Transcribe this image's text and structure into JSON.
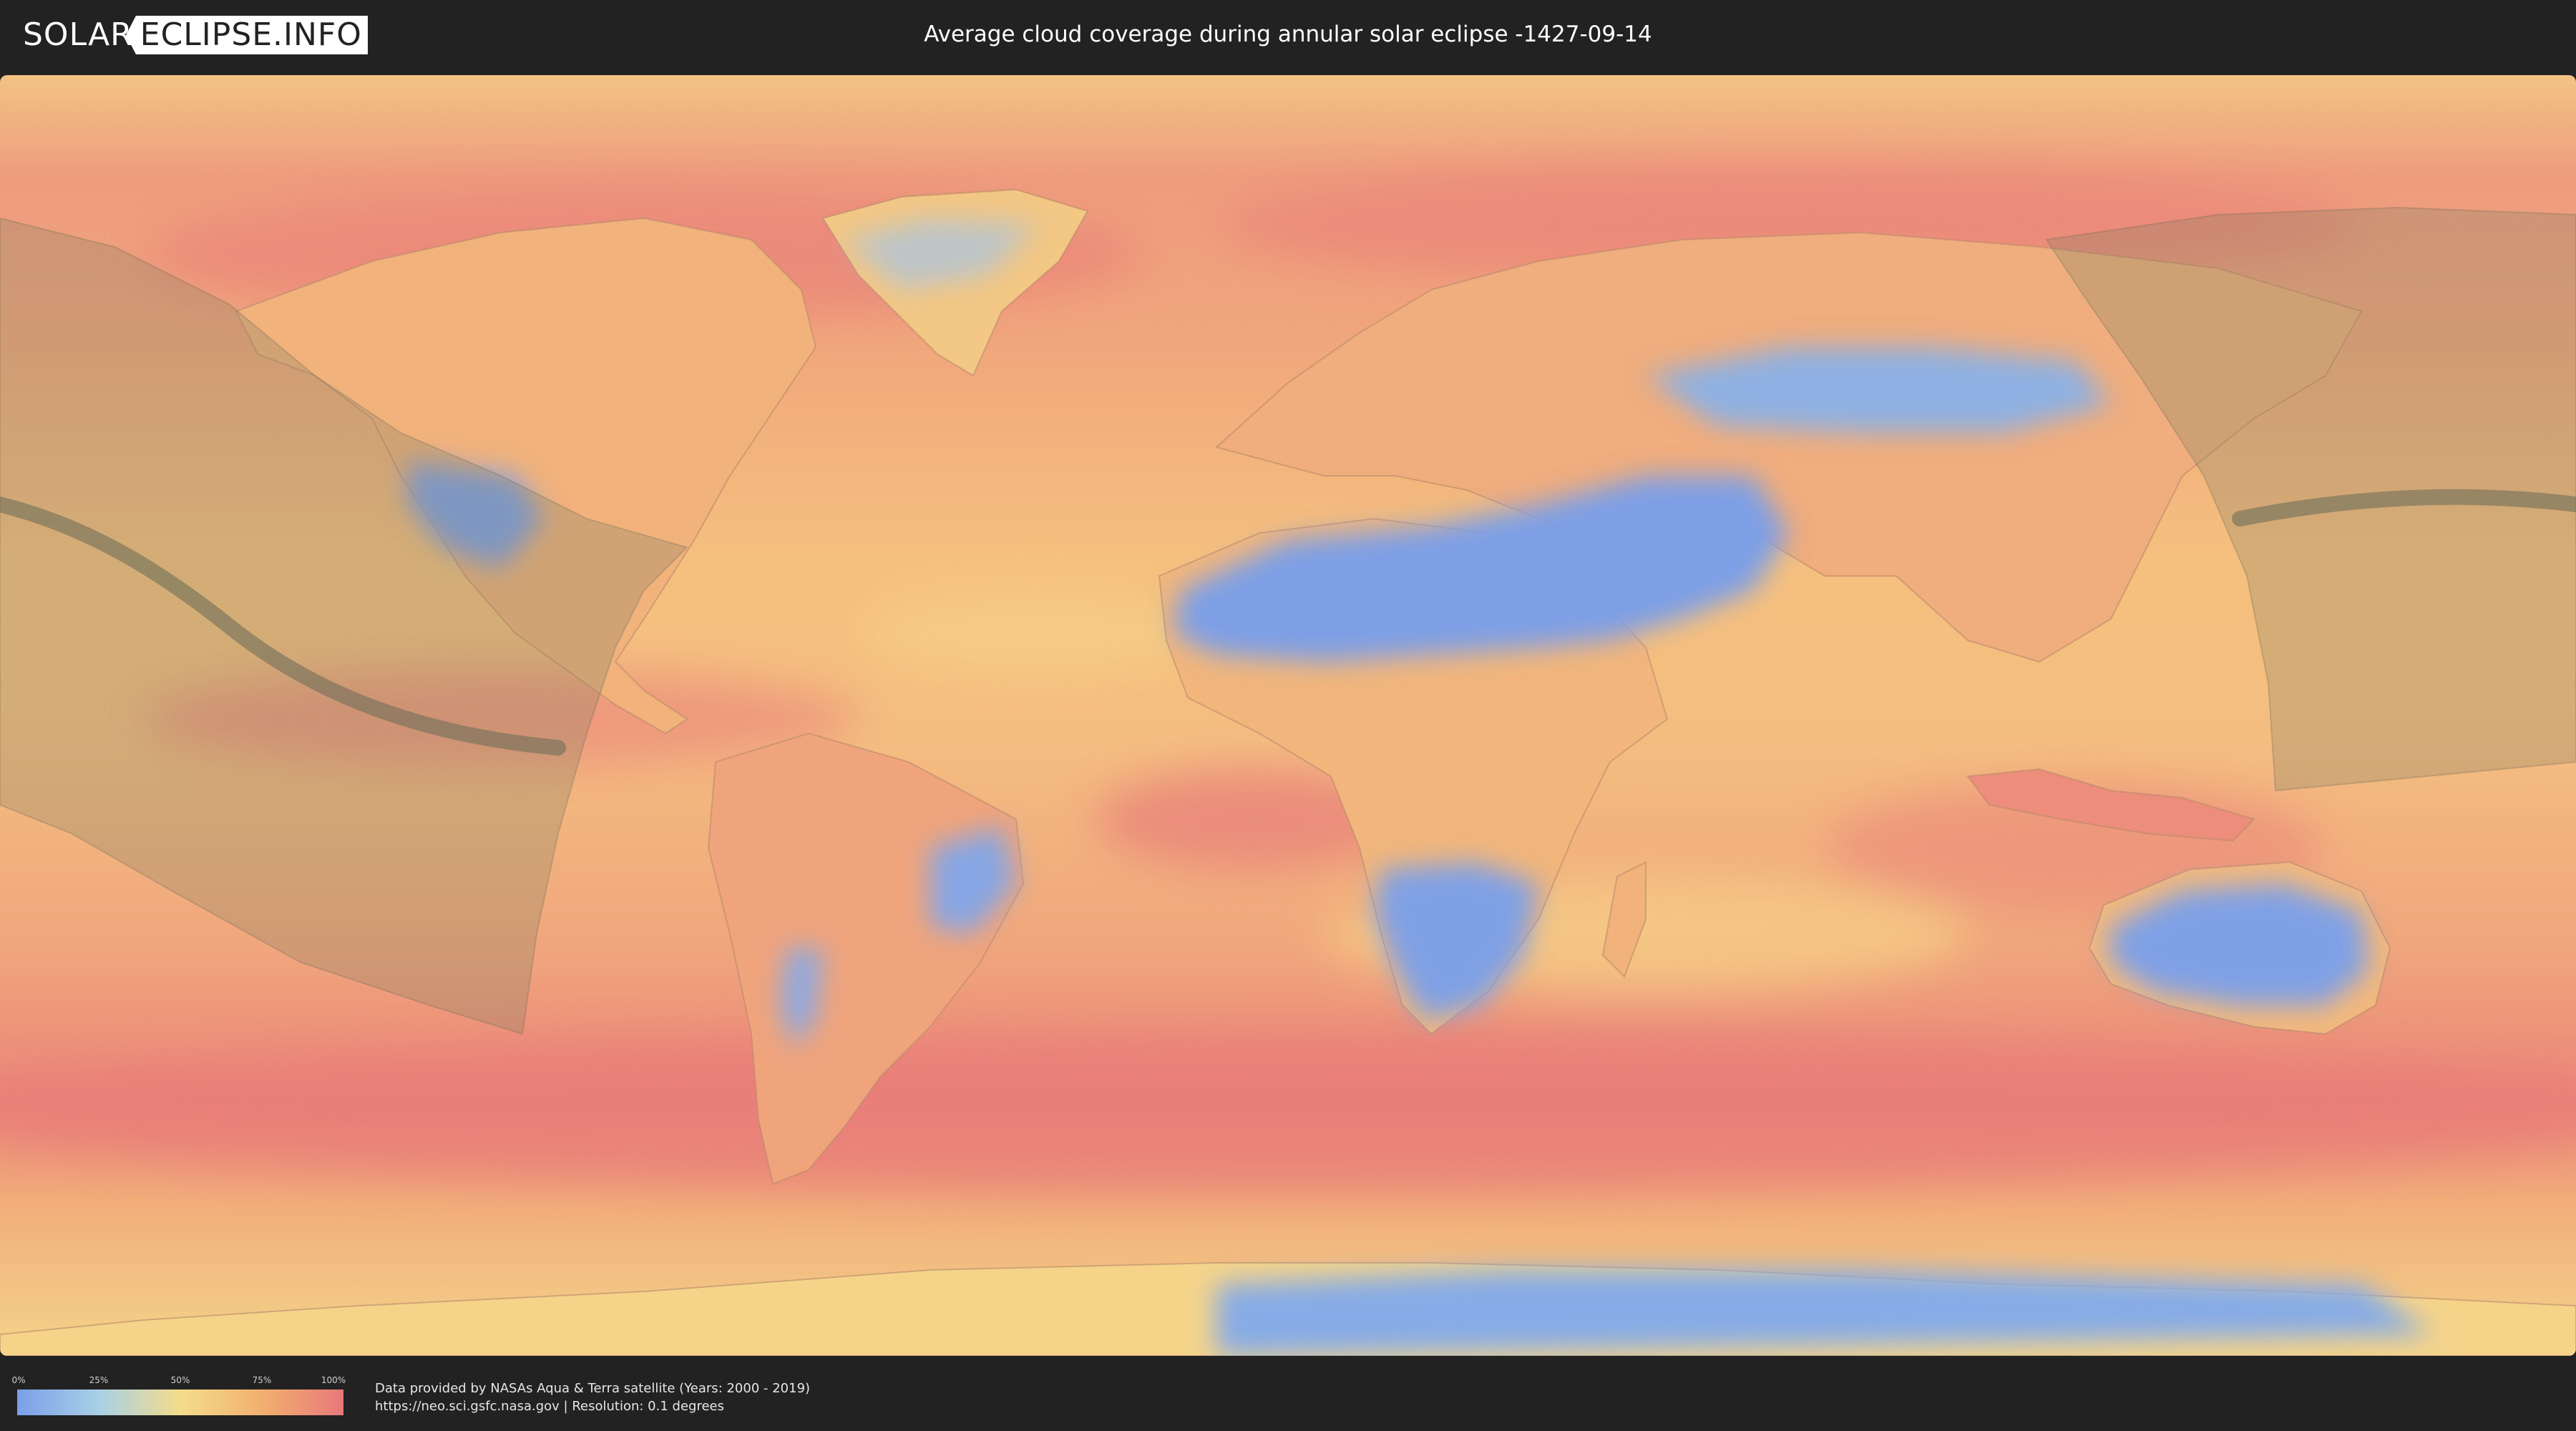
{
  "header": {
    "logo_left": "SOLAR",
    "logo_right": "ECLIPSE.INFO",
    "title": "Average cloud coverage during annular solar eclipse -1427-09-14"
  },
  "legend": {
    "ticks": [
      "0%",
      "25%",
      "50%",
      "75%",
      "100%"
    ],
    "colors": [
      "#7c9ee8",
      "#a8d0e6",
      "#f4dc8c",
      "#f2b070",
      "#e8787a"
    ]
  },
  "attribution": {
    "line1": "Data provided by NASAs Aqua & Terra satellite (Years: 2000 - 2019)",
    "line2": "https://neo.sci.gsfc.nasa.gov | Resolution: 0.1 degrees"
  },
  "map": {
    "projection": "equirectangular",
    "colors": {
      "ocean_cloudy": "#ec8a7c",
      "ocean_mid": "#f4b47a",
      "clear_sky": "#7d9fe6",
      "partial": "#f6d88e",
      "eclipse_zone": "#8a8a6e",
      "central_line": "#6e6e5a"
    }
  }
}
